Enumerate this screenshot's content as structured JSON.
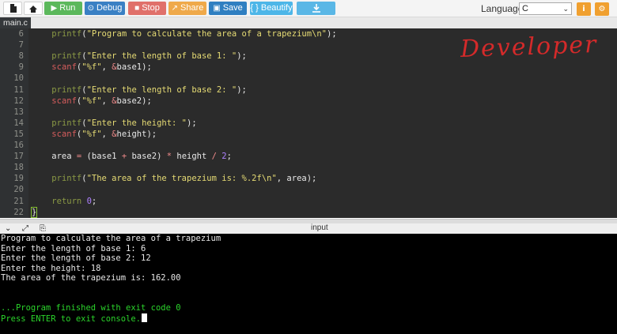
{
  "toolbar": {
    "run_label": "Run",
    "debug_label": "Debug",
    "stop_label": "Stop",
    "share_label": "Share",
    "save_label": "Save",
    "beautify_label": "{ } Beautify",
    "language_label": "Language",
    "language_value": "C",
    "icons": [
      "file-icon",
      "upload-icon",
      "download-icon",
      "info-icon",
      "gear-icon"
    ],
    "colors": {
      "run": "#5cb85c",
      "debug": "#3a80c4",
      "stop": "#e0706a",
      "share": "#efa94a",
      "save": "#2f7fc1",
      "beautify": "#4db6e8",
      "download": "#5ab7e6",
      "settings": "#f0a030"
    }
  },
  "tab": {
    "label": "main.c"
  },
  "editor": {
    "watermark": "Developer",
    "lines": [
      {
        "n": "6",
        "tokens": [
          [
            "    ",
            "plain"
          ],
          [
            "printf",
            "fn"
          ],
          [
            "(",
            "plain"
          ],
          [
            "\"Program to calculate the area of a trapezium\\n\"",
            "str"
          ],
          [
            ");",
            "plain"
          ]
        ]
      },
      {
        "n": "7",
        "tokens": []
      },
      {
        "n": "8",
        "tokens": [
          [
            "    ",
            "plain"
          ],
          [
            "printf",
            "fn"
          ],
          [
            "(",
            "plain"
          ],
          [
            "\"Enter the length of base 1: \"",
            "str"
          ],
          [
            ");",
            "plain"
          ]
        ]
      },
      {
        "n": "9",
        "tokens": [
          [
            "    ",
            "plain"
          ],
          [
            "scanf",
            "scanf"
          ],
          [
            "(",
            "plain"
          ],
          [
            "\"%f\"",
            "str"
          ],
          [
            ", ",
            "plain"
          ],
          [
            "&",
            "op"
          ],
          [
            "base1);",
            "plain"
          ]
        ]
      },
      {
        "n": "10",
        "tokens": []
      },
      {
        "n": "11",
        "tokens": [
          [
            "    ",
            "plain"
          ],
          [
            "printf",
            "fn"
          ],
          [
            "(",
            "plain"
          ],
          [
            "\"Enter the length of base 2: \"",
            "str"
          ],
          [
            ");",
            "plain"
          ]
        ]
      },
      {
        "n": "12",
        "tokens": [
          [
            "    ",
            "plain"
          ],
          [
            "scanf",
            "scanf"
          ],
          [
            "(",
            "plain"
          ],
          [
            "\"%f\"",
            "str"
          ],
          [
            ", ",
            "plain"
          ],
          [
            "&",
            "op"
          ],
          [
            "base2);",
            "plain"
          ]
        ]
      },
      {
        "n": "13",
        "tokens": []
      },
      {
        "n": "14",
        "tokens": [
          [
            "    ",
            "plain"
          ],
          [
            "printf",
            "fn"
          ],
          [
            "(",
            "plain"
          ],
          [
            "\"Enter the height: \"",
            "str"
          ],
          [
            ");",
            "plain"
          ]
        ]
      },
      {
        "n": "15",
        "tokens": [
          [
            "    ",
            "plain"
          ],
          [
            "scanf",
            "scanf"
          ],
          [
            "(",
            "plain"
          ],
          [
            "\"%f\"",
            "str"
          ],
          [
            ", ",
            "plain"
          ],
          [
            "&",
            "op"
          ],
          [
            "height);",
            "plain"
          ]
        ]
      },
      {
        "n": "16",
        "tokens": []
      },
      {
        "n": "17",
        "tokens": [
          [
            "    area ",
            "plain"
          ],
          [
            "=",
            "op"
          ],
          [
            " (base1 ",
            "plain"
          ],
          [
            "+",
            "op"
          ],
          [
            " base2) ",
            "plain"
          ],
          [
            "*",
            "op"
          ],
          [
            " height ",
            "plain"
          ],
          [
            "/",
            "op"
          ],
          [
            " ",
            "plain"
          ],
          [
            "2",
            "num"
          ],
          [
            ";",
            "plain"
          ]
        ]
      },
      {
        "n": "18",
        "tokens": []
      },
      {
        "n": "19",
        "tokens": [
          [
            "    ",
            "plain"
          ],
          [
            "printf",
            "fn"
          ],
          [
            "(",
            "plain"
          ],
          [
            "\"The area of the trapezium is: %.2f\\n\"",
            "str"
          ],
          [
            ", area);",
            "plain"
          ]
        ]
      },
      {
        "n": "20",
        "tokens": []
      },
      {
        "n": "21",
        "tokens": [
          [
            "    ",
            "plain"
          ],
          [
            "return",
            "kw"
          ],
          [
            " ",
            "plain"
          ],
          [
            "0",
            "num"
          ],
          [
            ";",
            "plain"
          ]
        ]
      },
      {
        "n": "22",
        "tokens": [
          [
            "}",
            "brace"
          ]
        ]
      }
    ]
  },
  "input_panel": {
    "label": "input"
  },
  "console": {
    "lines": [
      {
        "text": "Program to calculate the area of a trapezium",
        "color": "white"
      },
      {
        "text": "Enter the length of base 1: 6",
        "color": "white"
      },
      {
        "text": "Enter the length of base 2: 12",
        "color": "white"
      },
      {
        "text": "Enter the height: 18",
        "color": "white"
      },
      {
        "text": "The area of the trapezium is: 162.00",
        "color": "white"
      },
      {
        "text": "",
        "color": "white"
      },
      {
        "text": "",
        "color": "white"
      },
      {
        "text": "...Program finished with exit code 0",
        "color": "green"
      },
      {
        "text": "Press ENTER to exit console.",
        "color": "green",
        "cursor": true
      }
    ]
  }
}
